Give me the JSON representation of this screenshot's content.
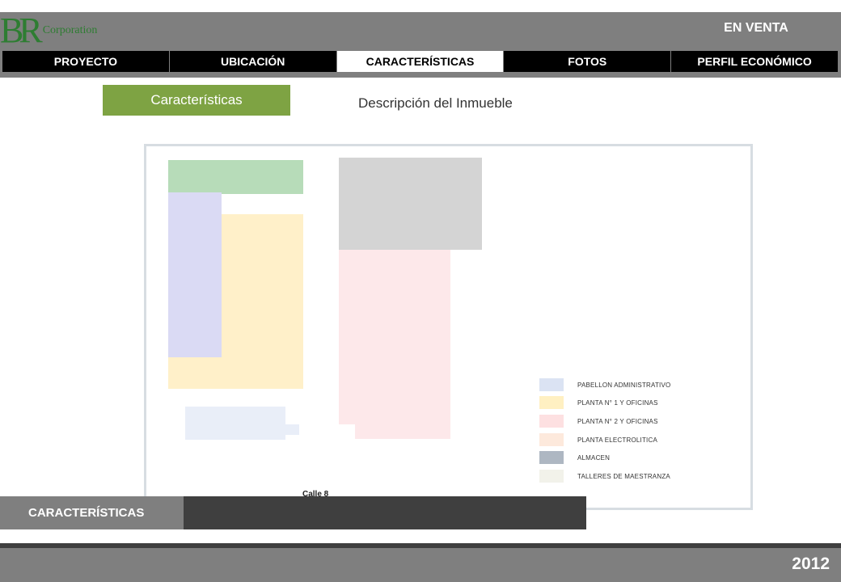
{
  "brand": {
    "mark": "BR",
    "name": "Corporation"
  },
  "status": "EN VENTA",
  "nav": {
    "tabs": [
      {
        "label": "PROYECTO",
        "active": false
      },
      {
        "label": "UBICACIÓN",
        "active": false
      },
      {
        "label": "CARACTERÍSTICAS",
        "active": true
      },
      {
        "label": "FOTOS",
        "active": false
      },
      {
        "label": "PERFIL ECONÓMICO",
        "active": false
      }
    ]
  },
  "section": {
    "badge": "Características",
    "title": "Descripción del Inmueble"
  },
  "plan": {
    "street": "Calle 8",
    "legend": [
      {
        "label": "PABELLON ADMINISTRATIVO",
        "color": "#dbe3f3"
      },
      {
        "label": "PLANTA N° 1 Y OFICINAS",
        "color": "#fff0c2"
      },
      {
        "label": "PLANTA N° 2 Y OFICINAS",
        "color": "#fde0e1"
      },
      {
        "label": "PLANTA ELECTROLITICA",
        "color": "#fde9dc"
      },
      {
        "label": "ALMACEN",
        "color": "#aeb7c2"
      },
      {
        "label": "TALLERES DE MAESTRANZA",
        "color": "#f2f2ea"
      }
    ]
  },
  "caption": "CARACTERÍSTICAS",
  "year": "2012",
  "colors": {
    "brand_green": "#2e7d32",
    "badge_green": "#7ea343",
    "bar_gray": "#7f7f7f"
  }
}
